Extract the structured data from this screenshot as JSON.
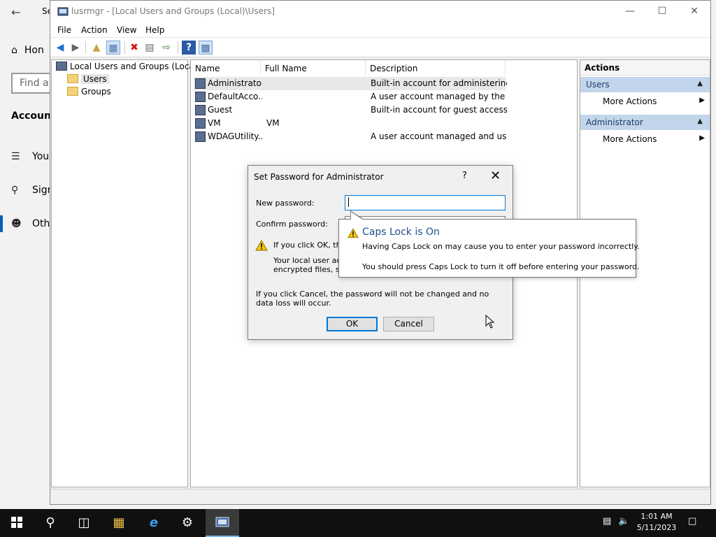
{
  "settings_bg": {
    "title": "Se",
    "home": "Hon",
    "find_placeholder": "Find a s",
    "section": "Accounts",
    "nav": [
      {
        "label": "You",
        "icon": "info-list-icon"
      },
      {
        "label": "Sign",
        "icon": "key-icon"
      },
      {
        "label": "Othe",
        "icon": "person-icon"
      }
    ]
  },
  "window": {
    "title": "lusrmgr - [Local Users and Groups (Local)\\Users]",
    "menu": [
      "File",
      "Action",
      "View",
      "Help"
    ]
  },
  "tree": {
    "root": "Local Users and Groups (Local)",
    "children": [
      "Users",
      "Groups"
    ]
  },
  "list": {
    "columns": [
      "Name",
      "Full Name",
      "Description"
    ],
    "rows": [
      {
        "name": "Administrator",
        "full_name": "",
        "description": "Built-in account for administering..."
      },
      {
        "name": "DefaultAcco...",
        "full_name": "",
        "description": "A user account managed by the s..."
      },
      {
        "name": "Guest",
        "full_name": "",
        "description": "Built-in account for guest access t..."
      },
      {
        "name": "VM",
        "full_name": "VM",
        "description": ""
      },
      {
        "name": "WDAGUtility...",
        "full_name": "",
        "description": "A user account managed and use..."
      }
    ]
  },
  "actions": {
    "header": "Actions",
    "groups": [
      {
        "title": "Users",
        "item": "More Actions"
      },
      {
        "title": "Administrator",
        "item": "More Actions"
      }
    ]
  },
  "dialog": {
    "title": "Set Password for Administrator",
    "help": "?",
    "new_password_label": "New password:",
    "confirm_password_label": "Confirm password:",
    "warning_line1": "If you click OK, the f",
    "warning_line2": "Your local user acco",
    "warning_line3": "encrypted files, store",
    "cancel_note": "If you click Cancel, the password will not be changed and no data loss will occur.",
    "ok": "OK",
    "cancel": "Cancel"
  },
  "balloon": {
    "title": "Caps Lock is On",
    "line1": "Having Caps Lock on may cause you to enter your password incorrectly.",
    "line2": "You should press Caps Lock to turn it off before entering your password."
  },
  "taskbar": {
    "time": "1:01 AM",
    "date": "5/11/2023"
  }
}
